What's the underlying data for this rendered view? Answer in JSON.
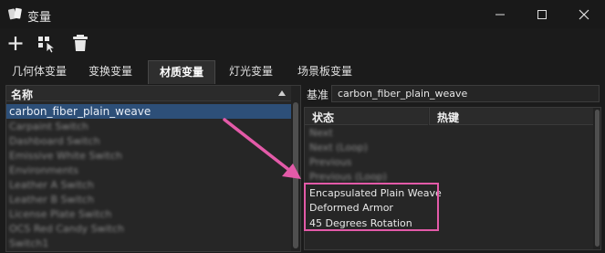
{
  "window": {
    "title": "变量",
    "icon": "cards-icon"
  },
  "window_controls": [
    "minimize-icon",
    "maximize-icon",
    "close-icon"
  ],
  "toolbar": {
    "icons": [
      "plus-icon",
      "select-cursor-icon",
      "trash-icon"
    ]
  },
  "tabs": [
    {
      "label": "几何体变量",
      "active": false
    },
    {
      "label": "变换变量",
      "active": false
    },
    {
      "label": "材质变量",
      "active": true
    },
    {
      "label": "灯光变量",
      "active": false
    },
    {
      "label": "场景板变量",
      "active": false
    }
  ],
  "left_panel": {
    "header": "名称",
    "selected": "carbon_fiber_plain_weave",
    "rows": [
      "Carpaint Switch",
      "Dashboard Switch",
      "Emissive White Switch",
      "Environments",
      "Leather A Switch",
      "Leather B Switch",
      "License Plate Switch",
      "OCS Red Candy Switch",
      "Switch1"
    ]
  },
  "right_panel": {
    "base_label": "基准",
    "base_value": "carbon_fiber_plain_weave",
    "columns": [
      "状态",
      "热键"
    ],
    "blurred_rows": [
      "Next",
      "Next (Loop)",
      "Previous",
      "Previous (Loop)"
    ],
    "rows": [
      "Encapsulated Plain Weave",
      "Deformed Armor",
      "45 Degrees Rotation"
    ]
  },
  "colors": {
    "selection": "#2d4f78",
    "annotation": "#e35aa8"
  }
}
